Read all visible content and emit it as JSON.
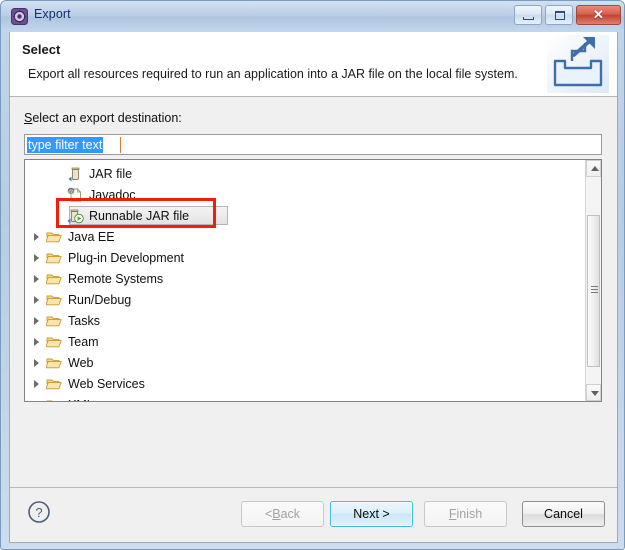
{
  "window": {
    "title": "Export",
    "icon": "eclipse-export-icon",
    "controls": {
      "minimize": "minimize-icon",
      "maximize": "maximize-icon",
      "close": "✕"
    }
  },
  "header": {
    "title": "Select",
    "description": "Export all resources required to run an application into a JAR file on the local file system.",
    "icon": "export-arrow-tray-icon"
  },
  "body": {
    "destination_label_mnemonic": "S",
    "destination_label_rest": "elect an export destination:",
    "filter": {
      "value": "type filter text",
      "selected": true
    },
    "tree_items": [
      {
        "label": "JAR file",
        "icon": "jar-file-icon",
        "leaf": true,
        "expandable": false,
        "selected": false
      },
      {
        "label": "Javadoc",
        "icon": "javadoc-icon",
        "leaf": true,
        "expandable": false,
        "selected": false
      },
      {
        "label": "Runnable JAR file",
        "icon": "runnable-jar-file-icon",
        "leaf": true,
        "expandable": false,
        "selected": true
      },
      {
        "label": "Java EE",
        "icon": "folder-icon",
        "leaf": false,
        "expandable": true,
        "selected": false
      },
      {
        "label": "Plug-in Development",
        "icon": "folder-icon",
        "leaf": false,
        "expandable": true,
        "selected": false
      },
      {
        "label": "Remote Systems",
        "icon": "folder-icon",
        "leaf": false,
        "expandable": true,
        "selected": false
      },
      {
        "label": "Run/Debug",
        "icon": "folder-icon",
        "leaf": false,
        "expandable": true,
        "selected": false
      },
      {
        "label": "Tasks",
        "icon": "folder-icon",
        "leaf": false,
        "expandable": true,
        "selected": false
      },
      {
        "label": "Team",
        "icon": "folder-icon",
        "leaf": false,
        "expandable": true,
        "selected": false
      },
      {
        "label": "Web",
        "icon": "folder-icon",
        "leaf": false,
        "expandable": true,
        "selected": false
      },
      {
        "label": "Web Services",
        "icon": "folder-icon",
        "leaf": false,
        "expandable": true,
        "selected": false
      },
      {
        "label": "XML",
        "icon": "folder-icon",
        "leaf": false,
        "expandable": true,
        "selected": false
      }
    ],
    "annotation": {
      "shape": "rectangle",
      "color": "#f41d0c",
      "target": "Runnable JAR file"
    }
  },
  "footer": {
    "help": "?",
    "buttons": [
      {
        "name": "back",
        "prefix": "< ",
        "mnemonic": "B",
        "suffix": "ack",
        "enabled": false,
        "default": false
      },
      {
        "name": "next",
        "prefix": "",
        "mnemonic": "N",
        "suffix": "ext >",
        "enabled": true,
        "default": true
      },
      {
        "name": "finish",
        "prefix": "",
        "mnemonic": "F",
        "suffix": "inish",
        "enabled": false,
        "default": false
      },
      {
        "name": "cancel",
        "prefix": "",
        "mnemonic": "C",
        "suffix": "ancel",
        "enabled": true,
        "default": false
      }
    ]
  }
}
